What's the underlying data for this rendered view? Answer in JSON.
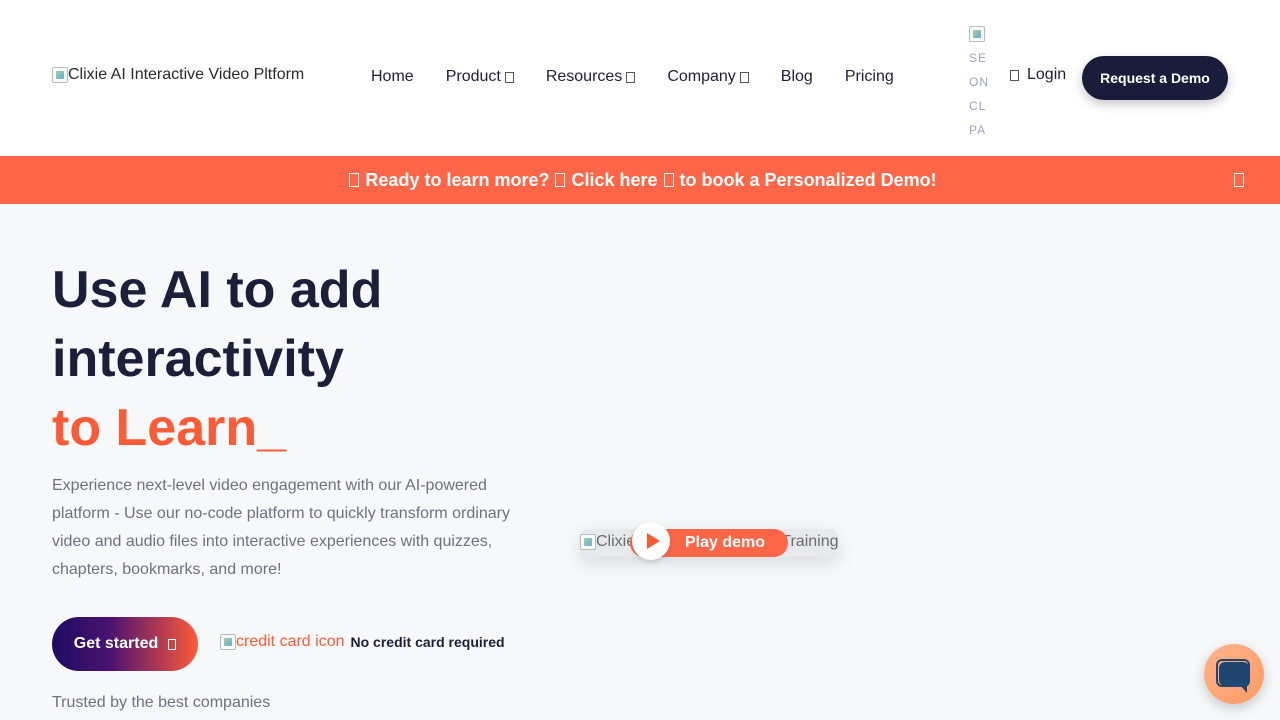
{
  "header": {
    "logo_alt": "Clixie AI Interactive Video Pltform",
    "nav": [
      {
        "label": "Home",
        "has_dropdown": false
      },
      {
        "label": "Product",
        "has_dropdown": true
      },
      {
        "label": "Resources",
        "has_dropdown": true
      },
      {
        "label": "Company",
        "has_dropdown": true
      },
      {
        "label": "Blog",
        "has_dropdown": false
      },
      {
        "label": "Pricing",
        "has_dropdown": false
      }
    ],
    "language_alt": [
      "SE",
      "ON",
      "CL",
      "PA"
    ],
    "login_label": "Login",
    "demo_label": "Request a Demo"
  },
  "banner": {
    "part1": "Ready to learn more?",
    "part2": "Click here",
    "part3": "to book a Personalized Demo!"
  },
  "hero": {
    "title_line1": "Use AI to add",
    "title_line2": "interactivity",
    "title_line3": "to Learn_",
    "description": "Experience next-level video engagement with our AI-powered platform - Use our no-code platform to quickly transform ordinary video and audio files into interactive experiences with quizzes, chapters, bookmarks, and more!",
    "cta_label": "Get started",
    "credit_alt": "credit card icon",
    "credit_text": "No credit card required",
    "trusted_text": "Trusted by the best companies"
  },
  "video": {
    "alt_text": "Clixie AI Interactive Video Training",
    "play_label": "Play demo"
  },
  "colors": {
    "accent": "#ff5a36",
    "banner": "#ff6647",
    "navy": "#1c1f3a"
  }
}
